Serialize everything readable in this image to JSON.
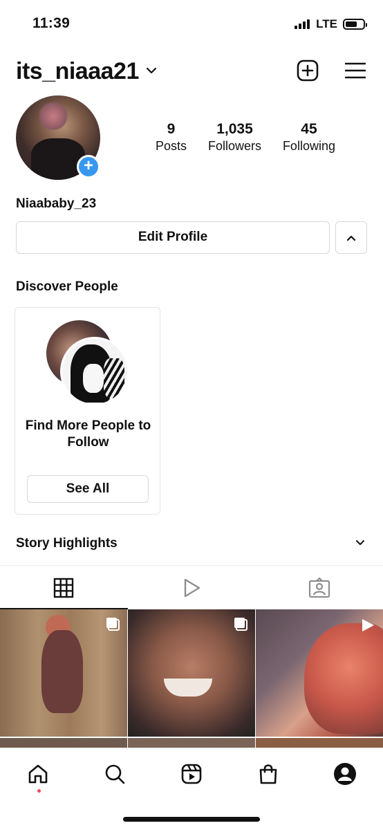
{
  "status_bar": {
    "time": "11:39",
    "network": "LTE"
  },
  "header": {
    "username": "its_niaaa21"
  },
  "profile": {
    "stats": [
      {
        "num": "9",
        "label": "Posts"
      },
      {
        "num": "1,035",
        "label": "Followers"
      },
      {
        "num": "45",
        "label": "Following"
      }
    ],
    "display_name": "Niaababy_23",
    "edit_label": "Edit Profile"
  },
  "discover": {
    "title": "Discover People",
    "card_text": "Find More People to Follow",
    "see_all": "See All"
  },
  "highlights": {
    "title": "Story Highlights"
  },
  "tabs": [
    {
      "icon": "grid-icon",
      "active": true
    },
    {
      "icon": "reels-play-icon",
      "active": false
    },
    {
      "icon": "tagged-person-icon",
      "active": false
    }
  ],
  "posts": [
    {
      "type": "carousel"
    },
    {
      "type": "carousel"
    },
    {
      "type": "reel"
    }
  ],
  "bottom_nav": [
    "home-icon",
    "search-icon",
    "reels-icon",
    "shop-icon",
    "profile-icon"
  ],
  "colors": {
    "accent_blue": "#3797f0",
    "notification_red": "#ed4956"
  }
}
